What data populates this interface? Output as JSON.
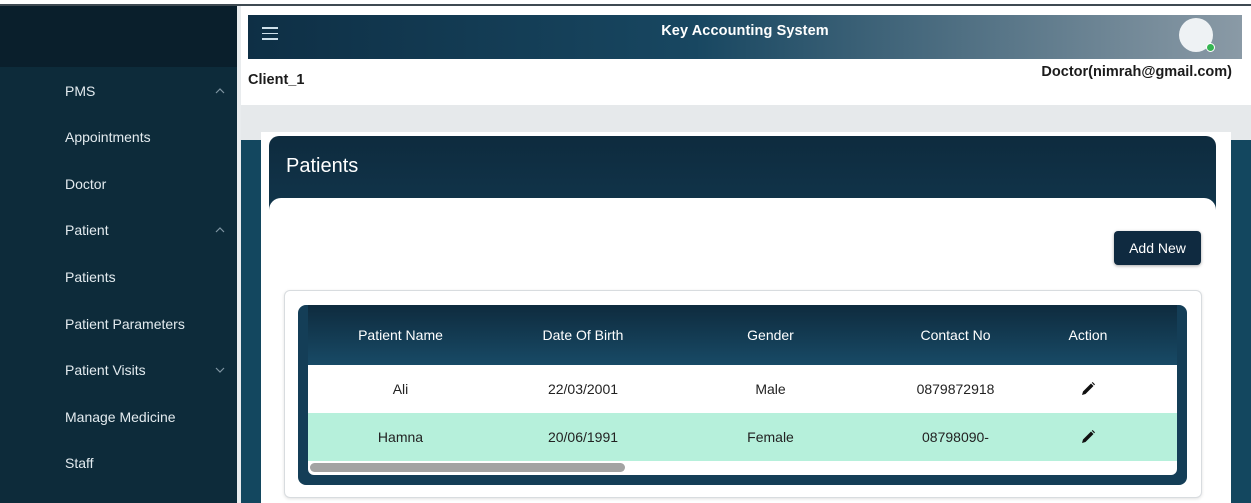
{
  "header": {
    "title": "Key Accounting System",
    "client": "Client_1",
    "user": "Doctor(nimrah@gmail.com)"
  },
  "sidebar": {
    "items": [
      {
        "label": "PMS",
        "chevron": "up"
      },
      {
        "label": "Appointments"
      },
      {
        "label": "Doctor"
      },
      {
        "label": "Patient",
        "chevron": "up"
      },
      {
        "label": "Patients"
      },
      {
        "label": "Patient Parameters"
      },
      {
        "label": "Patient Visits",
        "chevron": "down"
      },
      {
        "label": "Manage Medicine"
      },
      {
        "label": "Staff"
      }
    ]
  },
  "page": {
    "title": "Patients",
    "add_button": "Add New"
  },
  "table": {
    "columns": [
      "Patient Name",
      "Date Of Birth",
      "Gender",
      "Contact No",
      "Action"
    ],
    "rows": [
      {
        "name": "Ali",
        "dob": "22/03/2001",
        "gender": "Male",
        "contact": "0879872918"
      },
      {
        "name": "Hamna",
        "dob": "20/06/1991",
        "gender": "Female",
        "contact": "08798090-"
      }
    ]
  },
  "colors": {
    "sidebar": "#0d2b3a",
    "header_dark": "#0e2f45",
    "row_highlight": "#b6f0db",
    "button": "#0f2a40",
    "status_online": "#35b552"
  },
  "icons": {
    "menu": "hamburger-icon",
    "edit": "pencil-icon",
    "chevron_up": "chevron-up-icon",
    "chevron_down": "chevron-down-icon"
  }
}
